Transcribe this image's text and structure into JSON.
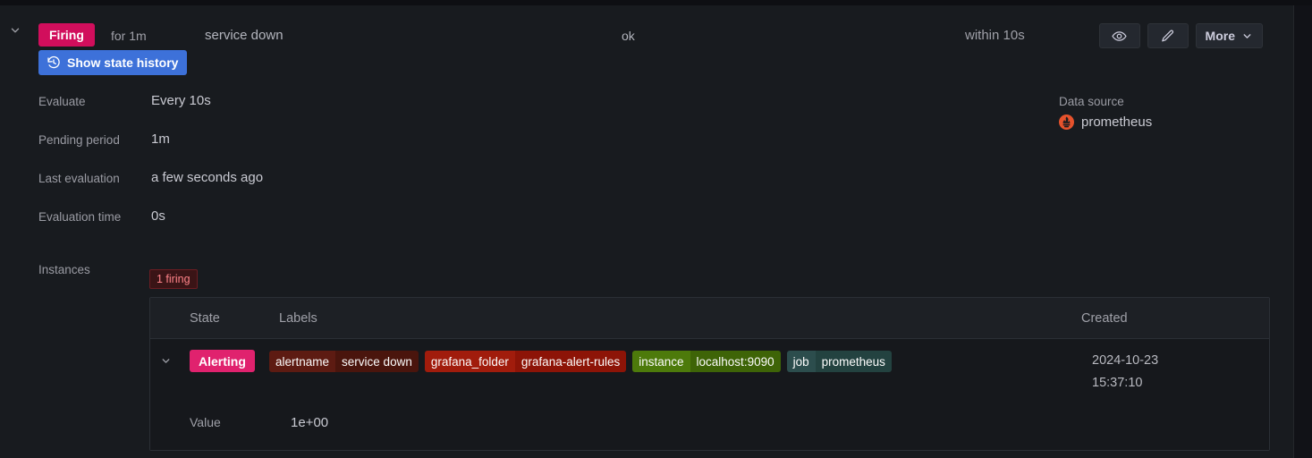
{
  "header": {
    "collapse_icon": "chevron-down-icon",
    "state_badge": "Firing",
    "state_for": "for 1m",
    "rule_name": "service down",
    "health": "ok",
    "next_evaluation": "within 10s",
    "view_icon": "eye-icon",
    "edit_icon": "pencil-icon",
    "more_label": "More",
    "more_chevron_icon": "chevron-down-icon",
    "show_state_history": {
      "label": "Show state history",
      "icon": "history-icon"
    }
  },
  "meta": [
    {
      "label": "Evaluate",
      "value": "Every 10s"
    },
    {
      "label": "Pending period",
      "value": "1m"
    },
    {
      "label": "Last evaluation",
      "value": "a few seconds ago"
    },
    {
      "label": "Evaluation time",
      "value": "0s"
    }
  ],
  "datasource": {
    "label": "Data source",
    "name": "prometheus",
    "icon": "prometheus-logo-icon"
  },
  "instances": {
    "label": "Instances",
    "firing_badge": "1 firing",
    "columns": {
      "state": "State",
      "labels": "Labels",
      "created": "Created"
    },
    "rows": [
      {
        "expand_icon": "chevron-down-icon",
        "state": "Alerting",
        "labels": [
          {
            "key": "alertname",
            "value": "service down",
            "key_color": "#5d1b12",
            "value_color": "#4a150d"
          },
          {
            "key": "grafana_folder",
            "value": "grafana-alert-rules",
            "key_color": "#a11c0c",
            "value_color": "#8d1407"
          },
          {
            "key": "instance",
            "value": "localhost:9090",
            "key_color": "#4d7a0b",
            "value_color": "#3e6407"
          },
          {
            "key": "job",
            "value": "prometheus",
            "key_color": "#2c4d4d",
            "value_color": "#234240"
          }
        ],
        "created_date": "2024-10-23",
        "created_time": "15:37:10",
        "value_label": "Value",
        "value_data": "1e+00"
      }
    ]
  },
  "colors": {
    "page_background": "#111217",
    "panel_background": "#181b1f",
    "firing_badge": "#d10e5c",
    "alerting_badge": "#e0226e",
    "primary_button": "#3d71d9",
    "prometheus_orange": "#e6522c",
    "text_primary": "#ccccdc",
    "text_secondary": "#9a9ba3"
  }
}
